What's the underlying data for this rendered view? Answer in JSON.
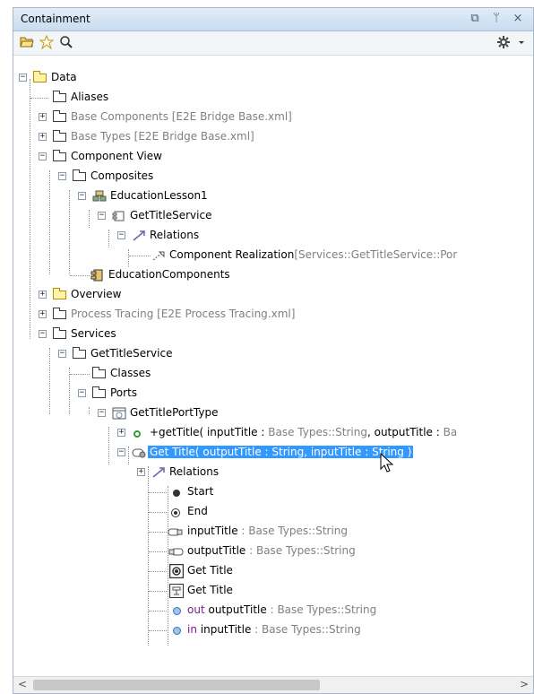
{
  "panel": {
    "title": "Containment",
    "title_buttons": [
      "restore-icon",
      "pin-icon",
      "close-icon"
    ],
    "close_glyph": "×",
    "pin_glyph": "ᛘ",
    "restore_glyph": "⧉"
  },
  "toolbar": {
    "left_icons": [
      "open-folder-icon",
      "star-icon",
      "search-icon"
    ],
    "right_icons": [
      "gear-icon",
      "chevron-down-icon"
    ]
  },
  "tree": {
    "data": "Data",
    "aliases": "Aliases",
    "base_components": "Base Components [E2E Bridge Base.xml]",
    "base_types": "Base Types [E2E Bridge Base.xml]",
    "component_view": "Component View",
    "composites": "Composites",
    "education_lesson": "EducationLesson1",
    "get_title_service_1": "GetTitleService",
    "relations_1": "Relations",
    "component_realization": "Component Realization",
    "component_realization_detail": "[Services::GetTitleService::Por",
    "education_components": "EducationComponents",
    "overview": "Overview",
    "process_tracing": "Process Tracing [E2E Process Tracing.xml]",
    "services": "Services",
    "get_title_service_2": "GetTitleService",
    "classes": "Classes",
    "ports": "Ports",
    "port_type": "GetTitlePortType",
    "op_name": "+getTitle( inputTitle : ",
    "op_type1": "Base Types::String",
    "op_mid": ", outputTitle : ",
    "op_type2": "Ba",
    "selected": "Get Title( outputTitle : String, inputTitle : String )",
    "relations_2": "Relations",
    "start": "Start",
    "end": "End",
    "input_title": "inputTitle",
    "input_title_type": " : Base Types::String",
    "output_title": "outputTitle",
    "output_title_type": " : Base Types::String",
    "get_title_a": "Get Title",
    "get_title_b": "Get Title",
    "out_kw": "out",
    "out_name": " outputTitle",
    "out_type": " : Base Types::String",
    "in_kw": "in",
    "in_name": " inputTitle",
    "in_type": " : Base Types::String"
  },
  "scrollbar": {
    "left": "<",
    "right": ">"
  },
  "colors": {
    "selection": "#3399ff",
    "titlebar": "#c9dcef",
    "type_gray": "#808080"
  }
}
